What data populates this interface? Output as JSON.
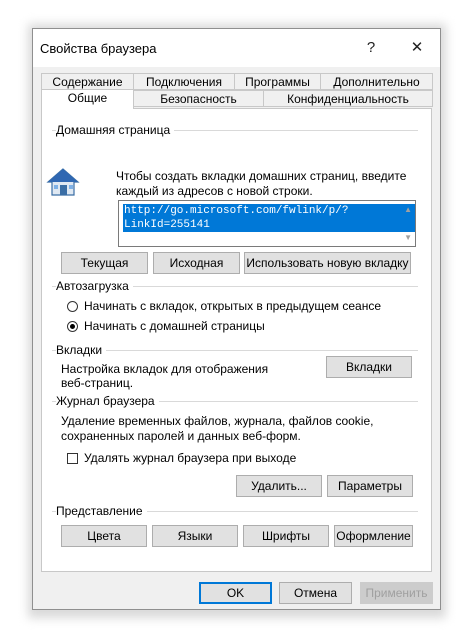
{
  "window": {
    "title": "Свойства браузера",
    "help_glyph": "?",
    "close_glyph": "✕"
  },
  "tabs_row1": [
    "Содержание",
    "Подключения",
    "Программы",
    "Дополнительно"
  ],
  "tabs_row2": [
    "Общие",
    "Безопасность",
    "Конфиденциальность"
  ],
  "active_tab": "Общие",
  "home": {
    "group": "Домашняя страница",
    "icon": "house-icon",
    "description_line1": "Чтобы создать вкладки домашних страниц, введите",
    "description_line2": "каждый из адресов с новой строки.",
    "url": "http://go.microsoft.com/fwlink/p/?LinkId=255141",
    "btn_current": "Текущая",
    "btn_original": "Исходная",
    "btn_new_tab": "Использовать новую вкладку"
  },
  "startup": {
    "group": "Автозагрузка",
    "option1": "Начинать с вкладок, открытых в предыдущем сеансе",
    "option2": "Начинать с домашней страницы",
    "selected": "option2"
  },
  "tabs_section": {
    "group": "Вкладки",
    "text_line1": "Настройка вкладок для отображения",
    "text_line2": "веб-страниц.",
    "button": "Вкладки"
  },
  "history": {
    "group": "Журнал браузера",
    "text_line1": "Удаление временных файлов, журнала, файлов cookie,",
    "text_line2": "сохраненных паролей и данных веб-форм.",
    "checkbox_label": "Удалять журнал браузера при выходе",
    "checkbox_checked": false,
    "btn_delete": "Удалить...",
    "btn_settings": "Параметры"
  },
  "appearance": {
    "group": "Представление",
    "btn_colors": "Цвета",
    "btn_languages": "Языки",
    "btn_fonts": "Шрифты",
    "btn_accessibility": "Оформление"
  },
  "footer": {
    "ok": "OK",
    "cancel": "Отмена",
    "apply": "Применить"
  },
  "colors": {
    "accent": "#0078d7",
    "dialog_bg": "#f0f0f0",
    "disabled_text": "#a0a0a0"
  }
}
